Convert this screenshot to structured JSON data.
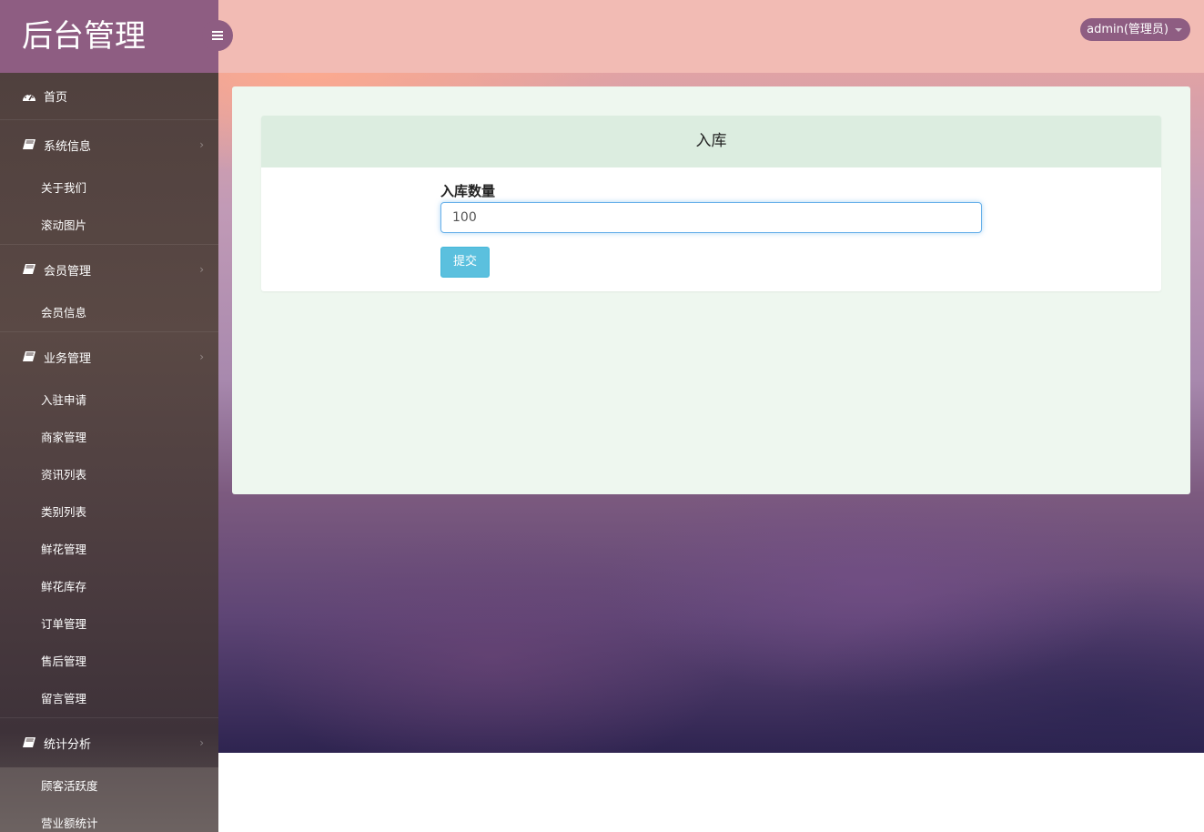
{
  "brand": {
    "title": "后台管理"
  },
  "header": {
    "user_label": "admin(管理员)"
  },
  "sidebar": {
    "home": {
      "label": "首页",
      "icon": "dashboard-icon"
    },
    "groups": [
      {
        "label": "系统信息",
        "icon": "book-icon",
        "items": [
          "关于我们",
          "滚动图片"
        ]
      },
      {
        "label": "会员管理",
        "icon": "book-icon",
        "items": [
          "会员信息"
        ]
      },
      {
        "label": "业务管理",
        "icon": "book-icon",
        "items": [
          "入驻申请",
          "商家管理",
          "资讯列表",
          "类别列表",
          "鲜花管理",
          "鲜花库存",
          "订单管理",
          "售后管理",
          "留言管理"
        ]
      },
      {
        "label": "统计分析",
        "icon": "book-icon",
        "items": [
          "顾客活跃度",
          "营业额统计"
        ]
      }
    ]
  },
  "form": {
    "title": "入库",
    "quantity_label": "入库数量",
    "quantity_value": "100",
    "submit_label": "提交"
  },
  "colors": {
    "brand": "#8e5d82",
    "topbar": "#f2bbb4",
    "panel": "#eef7ef",
    "card_header": "#dcede0",
    "button": "#5bc0de"
  }
}
